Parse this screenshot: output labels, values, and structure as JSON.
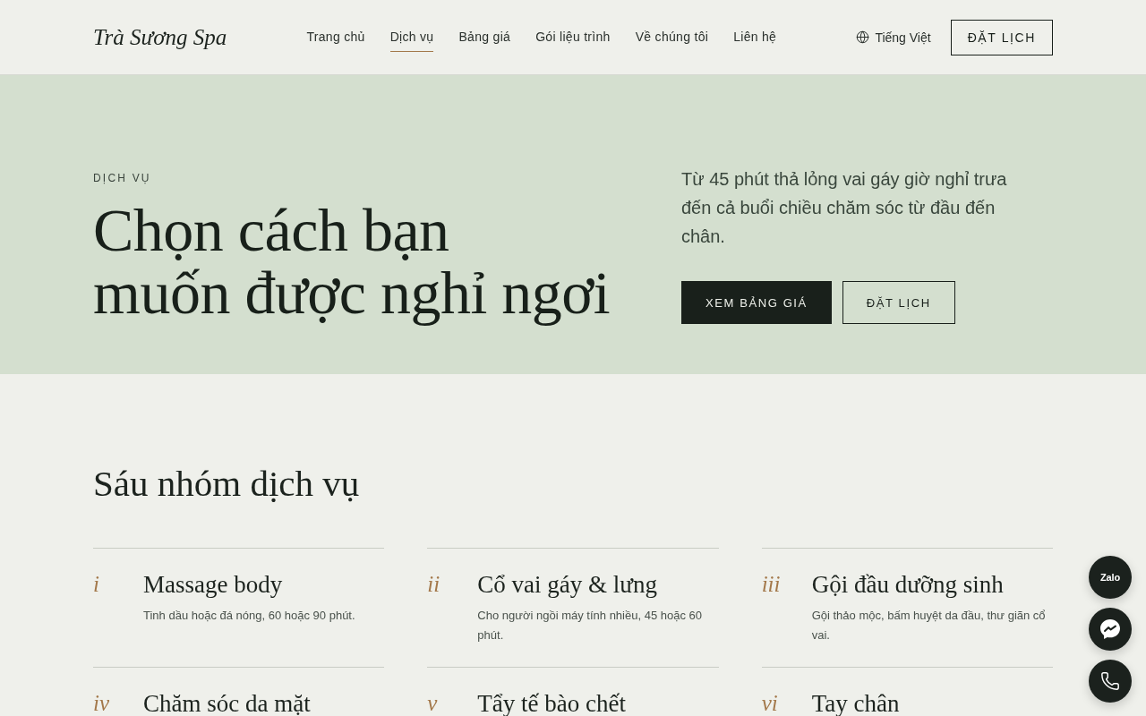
{
  "header": {
    "logo": "Trà Sương Spa",
    "nav": [
      {
        "label": "Trang chủ",
        "selected": false
      },
      {
        "label": "Dịch vụ",
        "selected": true
      },
      {
        "label": "Bảng giá",
        "selected": false
      },
      {
        "label": "Gói liệu trình",
        "selected": false
      },
      {
        "label": "Về chúng tôi",
        "selected": false
      },
      {
        "label": "Liên hệ",
        "selected": false
      }
    ],
    "language": "Tiếng Việt",
    "cta": "ĐẶT LỊCH"
  },
  "hero": {
    "eyebrow": "DỊCH VỤ",
    "title": "Chọn cách bạn\nmuốn được nghỉ ngơi",
    "lead": "Từ 45 phút thả lỏng vai gáy giờ nghỉ trưa đến cả buổi chiều chăm sóc từ đầu đến chân.",
    "buttons": [
      {
        "label": "XEM BẢNG GIÁ",
        "kind": "primary"
      },
      {
        "label": "ĐẶT LỊCH",
        "kind": "outline"
      }
    ]
  },
  "services": {
    "title": "Sáu nhóm dịch vụ",
    "items": [
      {
        "numeral": "i",
        "name": "Massage body",
        "description": "Tinh dầu hoặc đá nóng, 60 hoặc 90 phút."
      },
      {
        "numeral": "ii",
        "name": "Cổ vai gáy & lưng",
        "description": "Cho người ngồi máy tính nhiều, 45 hoặc 60 phút."
      },
      {
        "numeral": "iii",
        "name": "Gội đầu dưỡng sinh",
        "description": "Gội thảo mộc, bấm huyệt da đầu, thư giãn cổ vai."
      },
      {
        "numeral": "iv",
        "name": "Chăm sóc da mặt"
      },
      {
        "numeral": "v",
        "name": "Tẩy tế bào chết"
      },
      {
        "numeral": "vi",
        "name": "Tay chân"
      }
    ]
  },
  "floating_contacts": [
    {
      "kind": "zalo",
      "label": "Zalo"
    },
    {
      "kind": "messenger"
    },
    {
      "kind": "phone"
    }
  ]
}
